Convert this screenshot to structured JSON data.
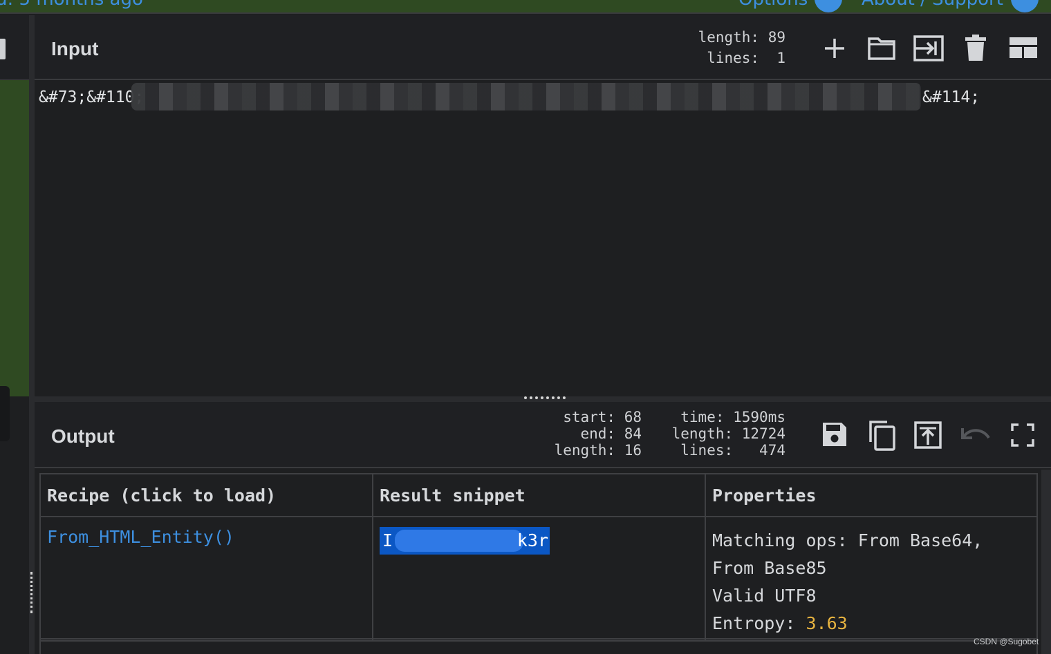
{
  "top_banner": {
    "timestamp_text": "d: 5 months ago",
    "options_label": "Options",
    "about_label": "About / Support"
  },
  "input": {
    "title": "Input",
    "stats": "length: 89\n lines:  1",
    "text_start": "&#73;&#110;",
    "text_end": "&#114;",
    "toolbar": [
      "add-icon",
      "folder-icon",
      "input-icon",
      "trash-icon",
      "layout-icon"
    ]
  },
  "output": {
    "title": "Output",
    "selection_stats": "start: 68\n   end: 84\nlength: 16",
    "output_stats": "  time: 1590ms\nlength: 12724\n lines:   474",
    "toolbar": [
      "save-icon",
      "copy-icon",
      "replace-input-icon",
      "undo-icon",
      "fullscreen-icon"
    ],
    "table": {
      "headers": [
        "Recipe (click to load)",
        "Result snippet",
        "Properties"
      ],
      "rows": [
        {
          "recipe": "From_HTML_Entity()",
          "snippet_start": "I",
          "snippet_end": "k3r",
          "props_line1": "Matching ops: From Base64,",
          "props_line2": "From Base85",
          "props_line3": "Valid UTF8",
          "entropy_label": "Entropy: ",
          "entropy_value": "3.63"
        }
      ]
    }
  },
  "watermark": "CSDN @Sugobet",
  "colors": {
    "accent": "#3d8fe0",
    "banner": "#2f4a22",
    "highlight": "#0b57c4",
    "entropy": "#e8b440"
  }
}
